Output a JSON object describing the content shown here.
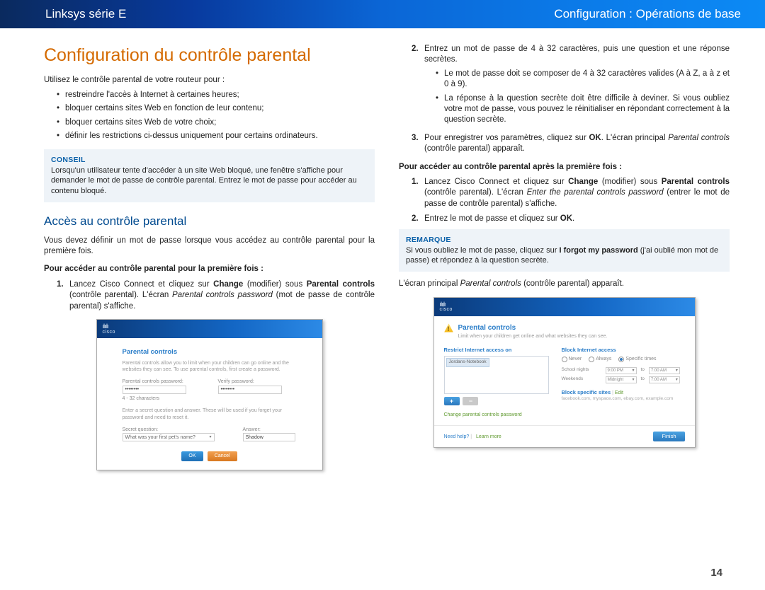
{
  "header": {
    "left": "Linksys série E",
    "right": "Configuration : Opérations de base"
  },
  "h1": "Configuration du contrôle parental",
  "intro": "Utilisez le contrôle parental de votre routeur pour :",
  "intro_items": [
    "restreindre l'accès à Internet à certaines heures;",
    "bloquer certains sites Web en fonction de leur contenu;",
    "bloquer certains sites Web de votre choix;",
    "définir les restrictions ci-dessus uniquement pour certains ordinateurs."
  ],
  "tip": {
    "title": "CONSEIL",
    "body": "Lorsqu'un utilisateur tente d'accéder à un site Web bloqué, une fenêtre s'affiche pour demander le mot de passe de contrôle parental. Entrez le mot de passe pour accéder au contenu bloqué."
  },
  "h2": "Accès au contrôle parental",
  "access_intro": "Vous devez définir un mot de passe lorsque vous accédez au contrôle parental pour la première fois.",
  "first_time_h": "Pour accéder au contrôle parental pour la première fois :",
  "step1_l": {
    "a": "Lancez Cisco Connect et cliquez sur ",
    "change": "Change",
    "b": " (modifier) sous ",
    "pc": "Parental controls",
    "c": " (contrôle parental). L'écran ",
    "pcp": "Parental controls password",
    "d": " (mot de passe de contrôle parental) s'affiche."
  },
  "step2_r": "Entrez un mot de passe de 4 à 32 caractères, puis une question et une réponse secrètes.",
  "step2_sub": [
    "Le mot de passe doit se composer de 4 à 32 caractères valides (A à Z, a à z et 0 à 9).",
    "La réponse à la question secrète doit être difficile à deviner. Si vous oubliez votre mot de passe, vous pouvez le réinitialiser en répondant correctement à la question secrète."
  ],
  "step3_r": {
    "a": "Pour enregistrer vos paramètres, cliquez sur ",
    "ok": "OK",
    "b": ". L'écran principal ",
    "pc": "Parental controls",
    "c": " (contrôle parental) apparaît."
  },
  "after_h": "Pour accéder au contrôle parental après la première fois :",
  "after1": {
    "a": "Lancez Cisco Connect et cliquez sur ",
    "change": "Change",
    "b": " (modifier) sous ",
    "pc": "Parental controls",
    "c": " (contrôle parental). L'écran ",
    "enter": "Enter the parental controls password",
    "d": " (entrer le mot de passe de contrôle parental) s'affiche."
  },
  "after2": {
    "a": "Entrez le mot de passe et cliquez sur ",
    "ok": "OK",
    "b": "."
  },
  "note": {
    "title": "REMARQUE",
    "a": "Si vous oubliez le mot de passe, cliquez sur ",
    "forgot": "I forgot my password",
    "b": " (j'ai oublié mon mot de passe) et répondez à la question secrète."
  },
  "main_screen": {
    "a": "L'écran principal ",
    "pc": "Parental controls",
    "b": " (contrôle parental) apparaît."
  },
  "page_num": "14",
  "mock1": {
    "title": "Parental controls",
    "desc": "Parental controls allow you to limit when your children can go online and the websites they can see. To use parental controls, first create a password.",
    "pw_lbl": "Parental controls password:",
    "vf_lbl": "Verify password:",
    "pw_val": "••••••••",
    "hint": "4 - 32 characters",
    "secret_desc": "Enter a secret question and answer. These will be used if you forget your password and need to reset it.",
    "sq_lbl": "Secret question:",
    "an_lbl": "Answer:",
    "sq_val": "What was your first pet's name?",
    "an_val": "Shadow",
    "ok": "OK",
    "cancel": "Cancel"
  },
  "mock2": {
    "title": "Parental controls",
    "desc": "Limit when your children get online and what websites they can see.",
    "restrict_h": "Restrict Internet access on",
    "block_h": "Block Internet access",
    "device": "Jordans-Notebook",
    "never": "Never",
    "always": "Always",
    "specific": "Specific times",
    "school": "School nights",
    "weekends": "Weekends",
    "t1a": "9:00 PM",
    "t1b": "7:00 AM",
    "t2a": "Midnight",
    "t2b": "7:00 AM",
    "to": "to",
    "block_sites_h": "Block specific sites",
    "edit": "Edit",
    "sites": "facebook.com, myspace.com, ebay.com, example.com",
    "change_pw": "Change parental controls password",
    "need_help": "Need help?",
    "learn": "Learn more",
    "finish": "Finish"
  }
}
